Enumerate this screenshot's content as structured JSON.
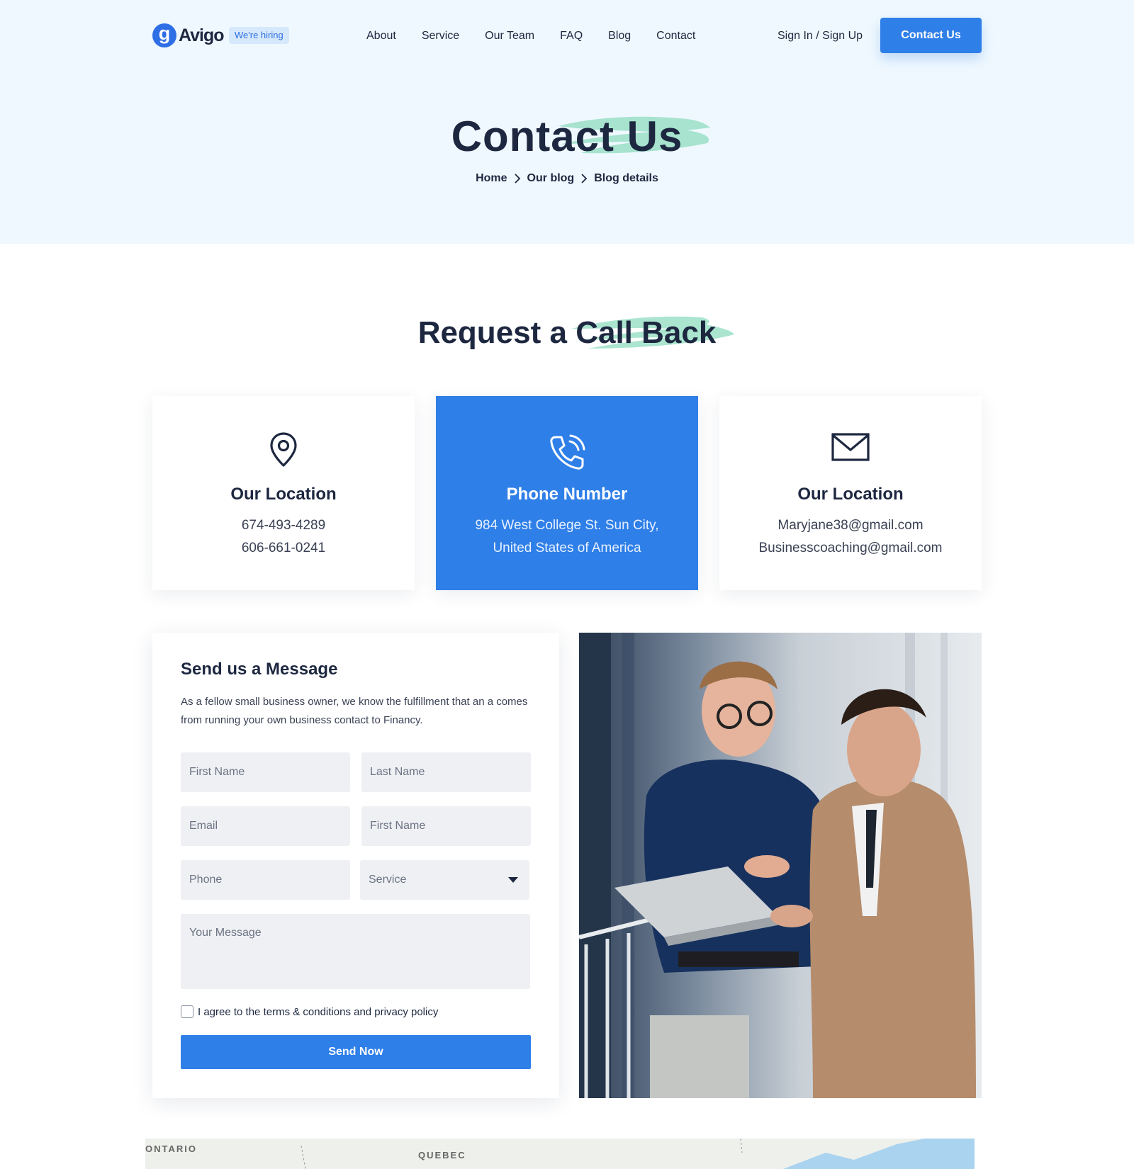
{
  "header": {
    "logo_mark": "g",
    "logo_text": "Avigo",
    "hiring_badge": "We're hiring",
    "nav": [
      "About",
      "Service",
      "Our Team",
      "FAQ",
      "Blog",
      "Contact"
    ],
    "signin": "Sign In / Sign Up",
    "cta": "Contact Us"
  },
  "hero": {
    "title": "Contact Us",
    "breadcrumb": [
      "Home",
      "Our blog",
      "Blog details"
    ]
  },
  "callback": {
    "title": "Request a Call Back",
    "cards": [
      {
        "icon": "location-pin-icon",
        "title": "Our Location",
        "lines": [
          "674-493-4289",
          "606-661-0241"
        ]
      },
      {
        "icon": "phone-icon",
        "title": "Phone Number",
        "lines": [
          "984 West College St. Sun City,",
          "United States of America"
        ]
      },
      {
        "icon": "envelope-icon",
        "title": "Our Location",
        "lines": [
          "Maryjane38@gmail.com",
          "Businesscoaching@gmail.com"
        ]
      }
    ]
  },
  "form": {
    "title": "Send us a Message",
    "description": "As a fellow small business owner, we know the fulfillment that an a comes from running your own business contact to Financy.",
    "fields": {
      "first_name": "First Name",
      "last_name": "Last Name",
      "email": "Email",
      "first_name_2": "First Name",
      "phone": "Phone",
      "service": "Service",
      "message": "Your Message"
    },
    "agree_label": "I agree to the terms & conditions and privacy policy",
    "submit": "Send Now"
  },
  "map": {
    "labels": [
      "ONTARIO",
      "QUEBEC"
    ]
  },
  "colors": {
    "accent": "#2f7fe8",
    "hero_bg": "#eff8fe",
    "heading": "#1d2740",
    "highlight_stroke": "#8fdcbf"
  }
}
